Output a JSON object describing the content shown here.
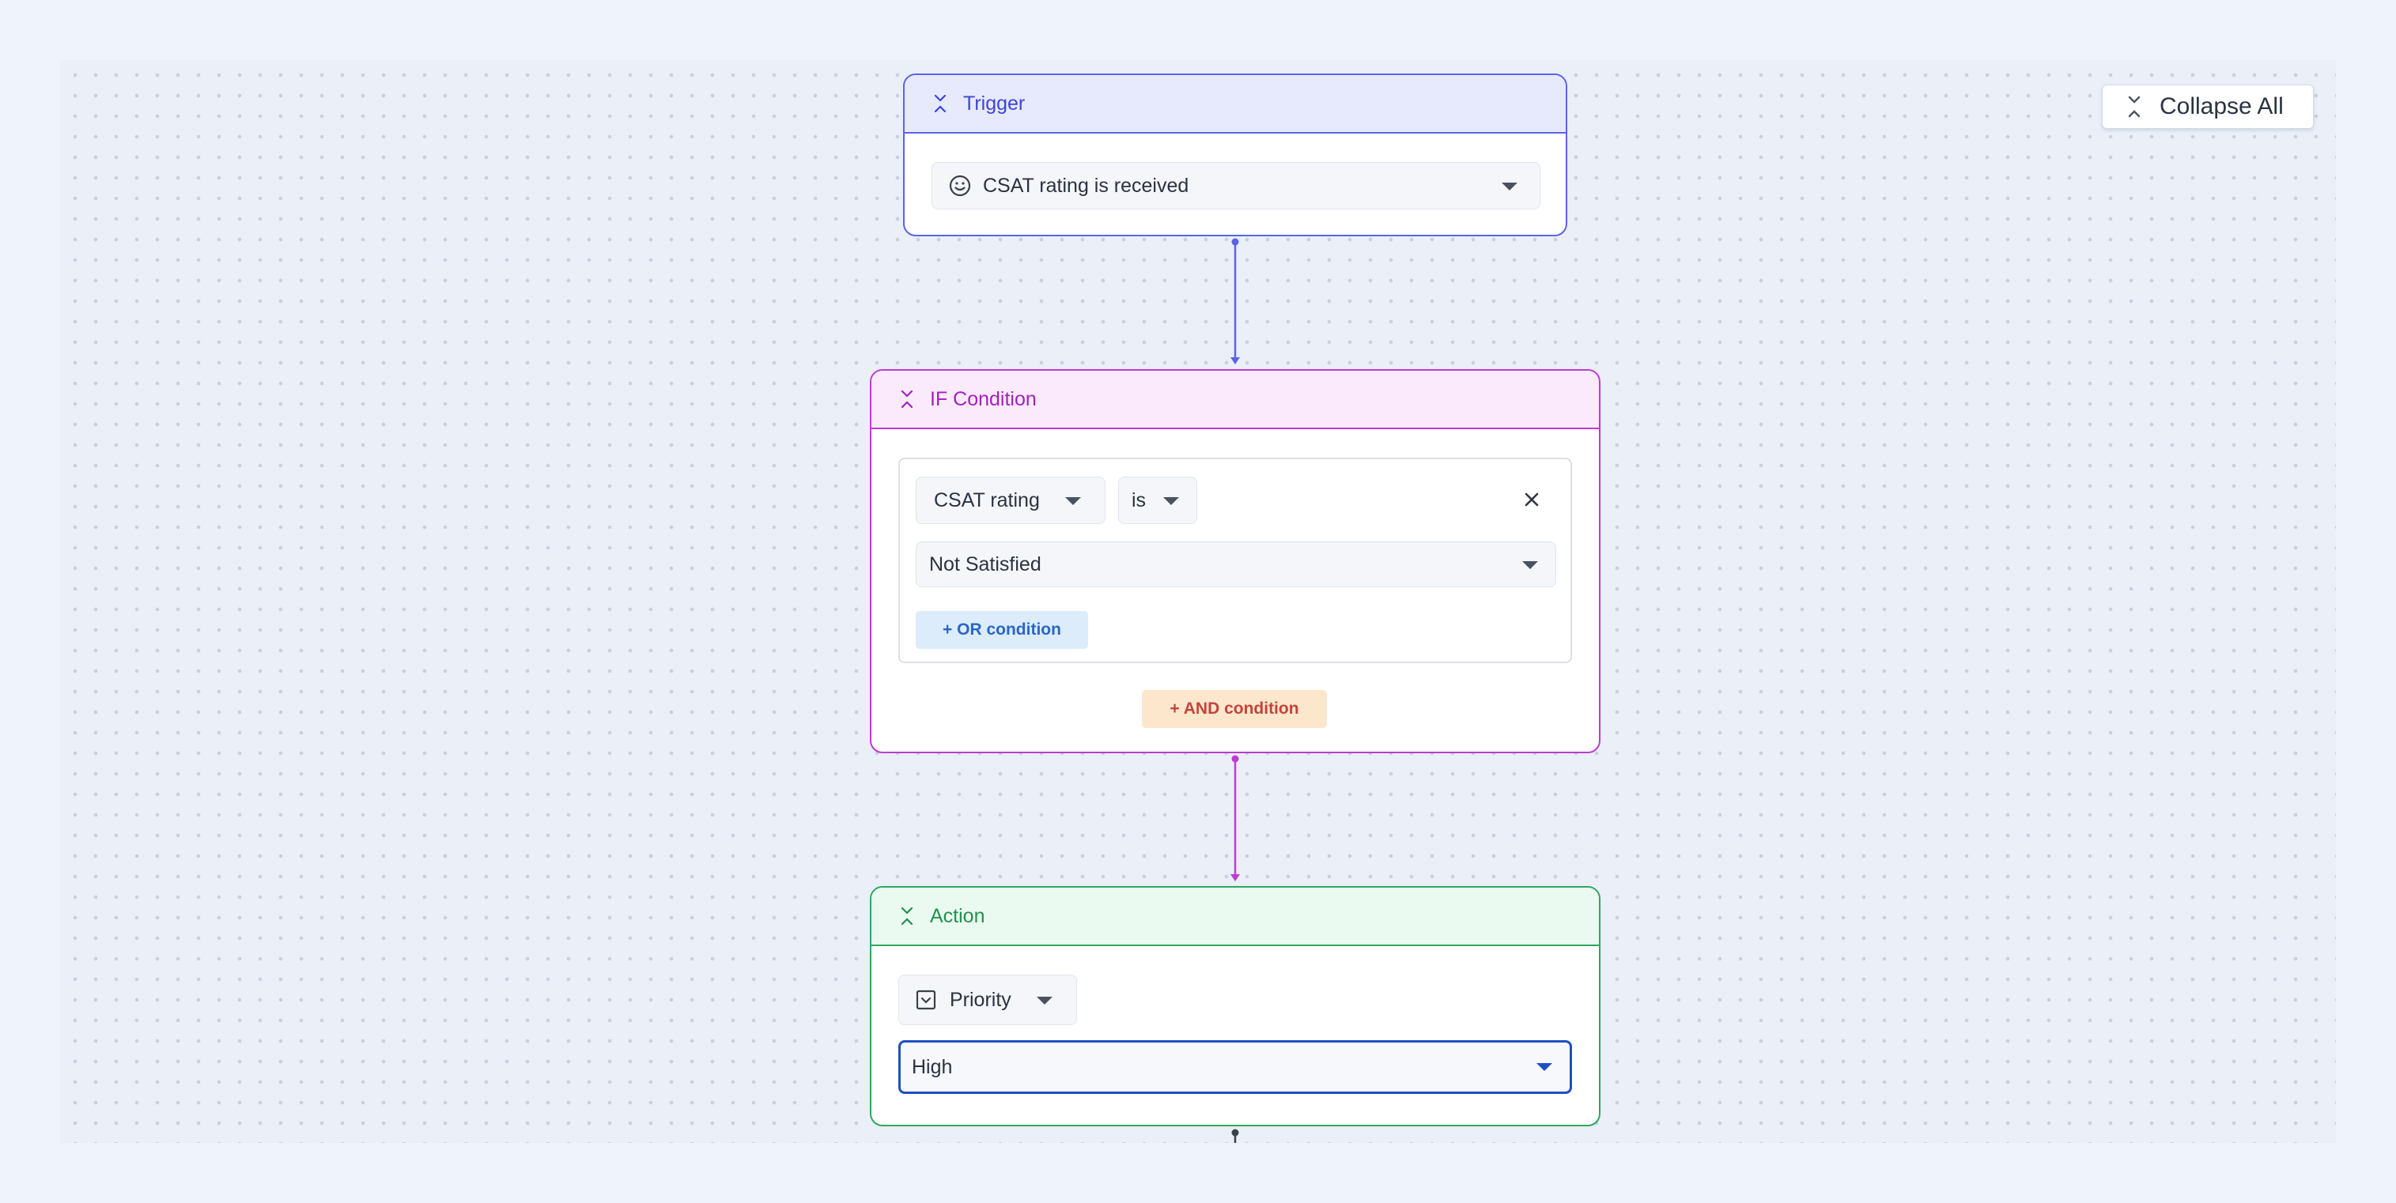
{
  "toolbar": {
    "collapse_all_label": "Collapse All"
  },
  "trigger": {
    "title": "Trigger",
    "event_value": "CSAT rating is received",
    "event_icon": "smiley-icon"
  },
  "if_condition": {
    "title": "IF Condition",
    "field_value": "CSAT rating",
    "operator_value": "is",
    "value_value": "Not Satisfied",
    "or_button_label": "+ OR condition",
    "and_button_label": "+ AND condition"
  },
  "action": {
    "title": "Action",
    "property_value": "Priority",
    "property_icon": "checkbox-dropdown-icon",
    "value_value": "High"
  },
  "colors": {
    "trigger": "#5b63e8",
    "if_condition": "#c03ad4",
    "action": "#2fa85c",
    "focus": "#1f4fc2"
  }
}
